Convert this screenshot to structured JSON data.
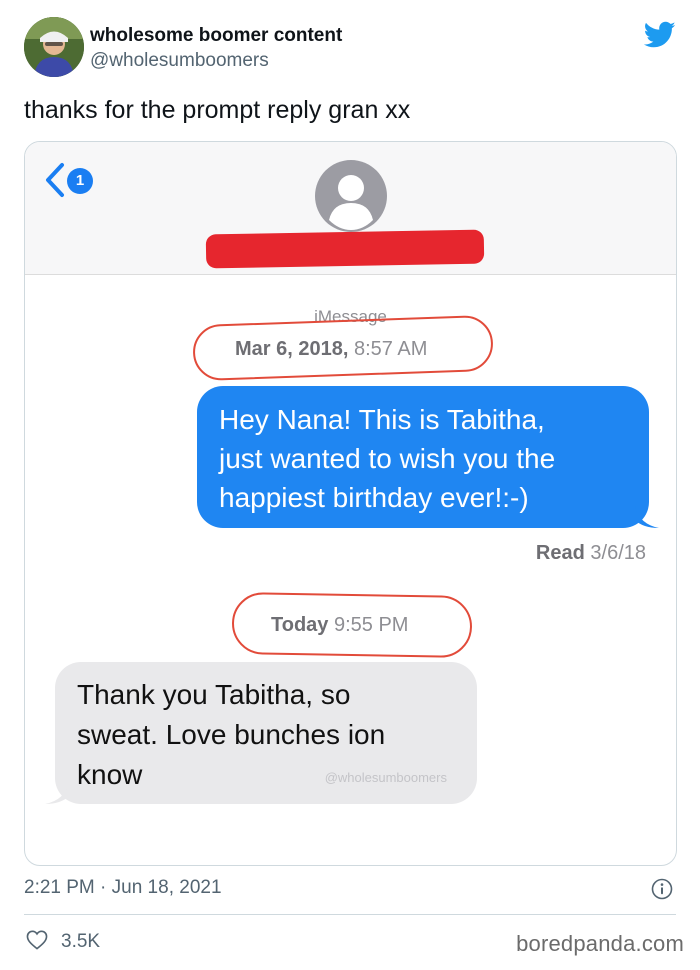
{
  "tweet": {
    "display_name": "wholesome boomer content",
    "handle": "@wholesumboomers",
    "text": "thanks for the prompt reply gran xx",
    "time": "2:21 PM · Jun 18, 2021",
    "likes": "3.5K"
  },
  "screenshot": {
    "back_badge": "1",
    "service": "iMessage",
    "messages": [
      {
        "type": "timestamp",
        "day": "Mar 6, 2018,",
        "time": "8:57 AM"
      },
      {
        "type": "sent",
        "lines": [
          "Hey Nana! This is Tabitha,",
          "just wanted to wish you the",
          "happiest birthday ever!:-)"
        ]
      },
      {
        "type": "receipt",
        "label": "Read",
        "date": "3/6/18"
      },
      {
        "type": "timestamp",
        "day": "Today",
        "time": "9:55 PM"
      },
      {
        "type": "received",
        "lines": [
          "Thank you Tabitha, so",
          "sweat.  Love bunches ion",
          "know"
        ]
      }
    ],
    "watermark": "@wholesumboomers"
  },
  "footer": {
    "brand": "boredpanda.com"
  },
  "colors": {
    "twitter_blue": "#1d9bf0",
    "imessage_blue": "#1f86f2",
    "received_gray": "#e9e9eb",
    "annotation_red": "#e24b3a"
  },
  "icons": [
    "twitter-bird-icon",
    "back-chevron-icon",
    "contact-silhouette-icon",
    "info-icon",
    "heart-icon"
  ]
}
